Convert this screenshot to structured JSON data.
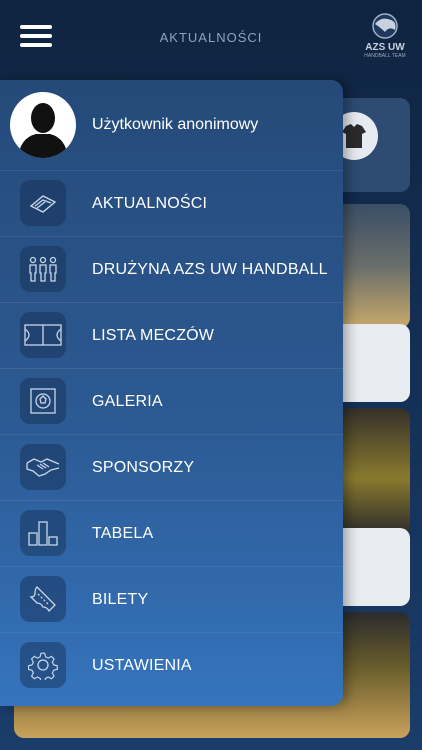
{
  "header": {
    "title": "AKTUALNOŚCI",
    "logo_main": "AZS UW",
    "logo_sub": "HANDBALL TEAM"
  },
  "drawer": {
    "user_name": "Użytkownik anonimowy",
    "items": [
      {
        "label": "AKTUALNOŚCI",
        "icon": "newspaper-icon"
      },
      {
        "label": "DRUŻYNA AZS UW HANDBALL",
        "icon": "team-icon"
      },
      {
        "label": "LISTA MECZÓW",
        "icon": "court-icon"
      },
      {
        "label": "GALERIA",
        "icon": "gallery-icon"
      },
      {
        "label": "SPONSORZY",
        "icon": "handshake-icon"
      },
      {
        "label": "TABELA",
        "icon": "podium-icon"
      },
      {
        "label": "BILETY",
        "icon": "ticket-icon"
      },
      {
        "label": "USTAWIENIA",
        "icon": "gear-icon"
      }
    ]
  },
  "colors": {
    "drawer_top": "#254a79",
    "drawer_bottom": "#3574bd",
    "background": "#10243d"
  }
}
